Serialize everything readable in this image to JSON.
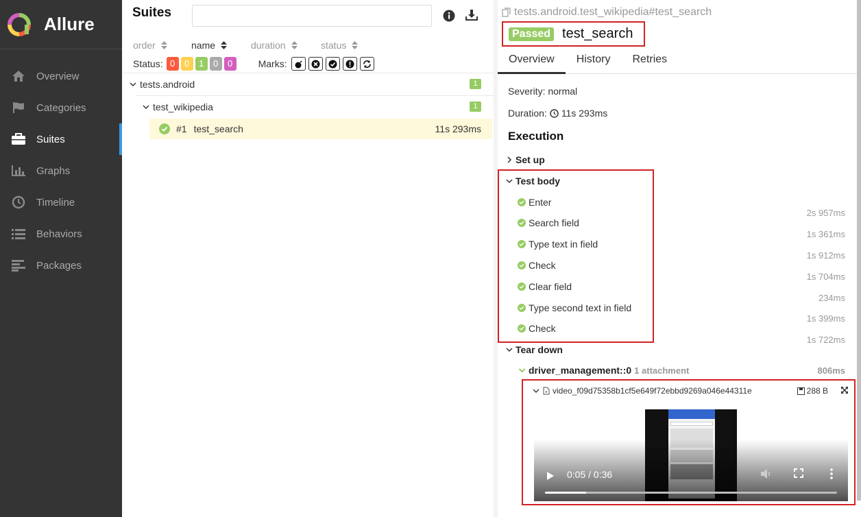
{
  "app": {
    "name": "Allure"
  },
  "sidebar": {
    "items": [
      {
        "label": "Overview",
        "icon": "home-icon"
      },
      {
        "label": "Categories",
        "icon": "flag-icon"
      },
      {
        "label": "Suites",
        "icon": "briefcase-icon",
        "active": true
      },
      {
        "label": "Graphs",
        "icon": "bar-chart-icon"
      },
      {
        "label": "Timeline",
        "icon": "clock-icon"
      },
      {
        "label": "Behaviors",
        "icon": "list-icon"
      },
      {
        "label": "Packages",
        "icon": "align-left-icon"
      }
    ]
  },
  "suites": {
    "title": "Suites",
    "search_placeholder": "",
    "sort": [
      "order",
      "name",
      "duration",
      "status"
    ],
    "status_label": "Status:",
    "status_counts": [
      "0",
      "0",
      "1",
      "0",
      "0"
    ],
    "marks_label": "Marks:",
    "tree": {
      "suite": {
        "name": "tests.android",
        "count": "1"
      },
      "subsuite": {
        "name": "test_wikipedia",
        "count": "1"
      },
      "test": {
        "index": "#1",
        "name": "test_search",
        "duration": "11s 293ms"
      }
    }
  },
  "testcase": {
    "breadcrumb": "tests.android.test_wikipedia#test_search",
    "status": "Passed",
    "name": "test_search",
    "tabs": [
      "Overview",
      "History",
      "Retries"
    ],
    "severity_label": "Severity:",
    "severity": "normal",
    "duration_label": "Duration:",
    "duration": "11s 293ms",
    "execution_title": "Execution",
    "setup_label": "Set up",
    "body_label": "Test body",
    "steps": [
      {
        "name": "Enter",
        "time": "2s 957ms"
      },
      {
        "name": "Search field",
        "time": "1s 361ms"
      },
      {
        "name": "Type text in field",
        "time": "1s 912ms"
      },
      {
        "name": "Check",
        "time": "1s 704ms"
      },
      {
        "name": "Clear field",
        "time": "234ms"
      },
      {
        "name": "Type second text in field",
        "time": "1s 399ms"
      },
      {
        "name": "Check",
        "time": "1s 722ms"
      }
    ],
    "teardown_label": "Tear down",
    "fixture": {
      "name": "driver_management::0",
      "attachments": "1 attachment",
      "time": "806ms"
    },
    "attachment": {
      "name": "video_f09d75358b1cf5e649f72ebbd9269a046e44311e",
      "size": "288 B",
      "video_time": "0:05 / 0:36",
      "progress": 0.14
    }
  },
  "colors": {
    "passed": "#97cc64",
    "failed": "#fd5a3e",
    "broken": "#ffd050",
    "skipped": "#aaaaaa",
    "unknown": "#d35ebe",
    "highlight": "#d32222",
    "accent": "#3b98e0"
  }
}
